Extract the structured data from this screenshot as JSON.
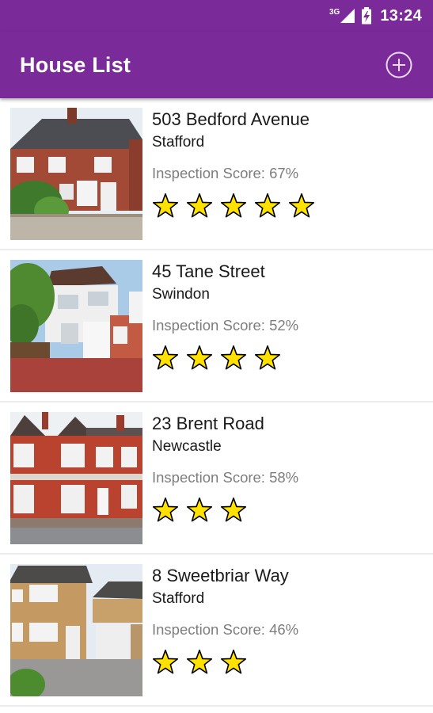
{
  "status_bar": {
    "network": "3G",
    "time": "13:24"
  },
  "app_bar": {
    "title": "House List",
    "add_icon": "add-circle-icon"
  },
  "houses": [
    {
      "address": "503 Bedford Avenue",
      "city": "Stafford",
      "score_label": "Inspection Score:",
      "score": "67%",
      "stars": 5
    },
    {
      "address": "45 Tane Street",
      "city": "Swindon",
      "score_label": "Inspection Score:",
      "score": "52%",
      "stars": 4
    },
    {
      "address": "23 Brent Road",
      "city": "Newcastle",
      "score_label": "Inspection Score:",
      "score": "58%",
      "stars": 3
    },
    {
      "address": "8 Sweetbriar Way",
      "city": "Stafford",
      "score_label": "Inspection Score:",
      "score": "46%",
      "stars": 3
    }
  ],
  "colors": {
    "primary": "#7b2a99",
    "star_fill": "#ffe100",
    "star_stroke": "#000000",
    "score_text": "#7d7d7d"
  }
}
